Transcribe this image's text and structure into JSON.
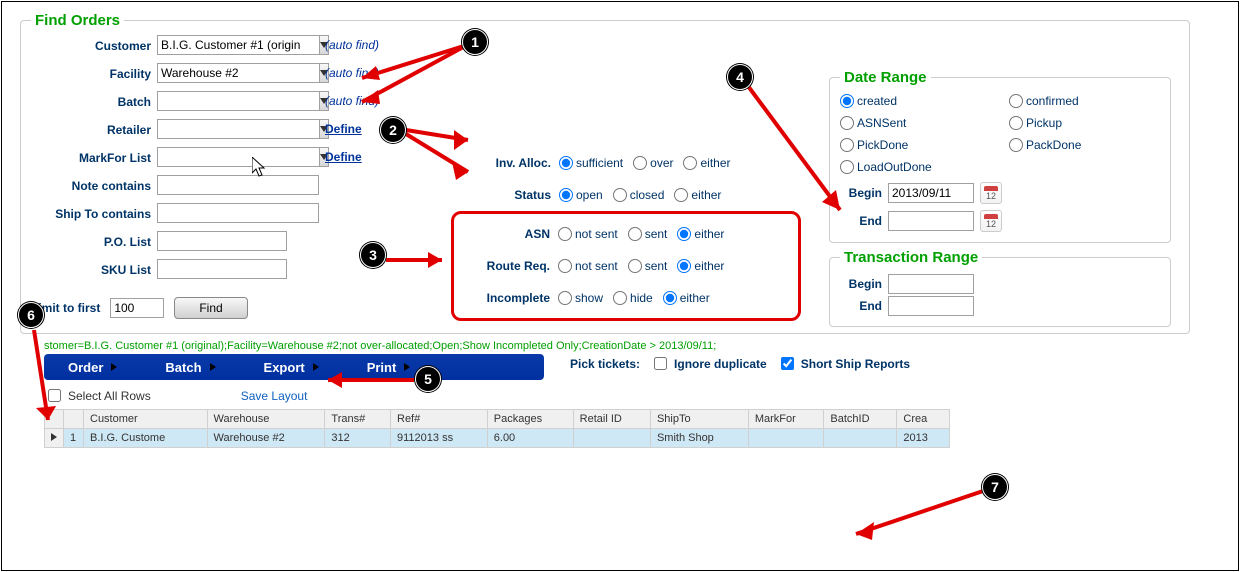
{
  "findOrders": {
    "legend": "Find Orders",
    "fields": {
      "customer": {
        "label": "Customer",
        "value": "B.I.G. Customer #1 (origin",
        "auto": "(auto find)"
      },
      "facility": {
        "label": "Facility",
        "value": "Warehouse #2",
        "auto": "(auto find)"
      },
      "batch": {
        "label": "Batch",
        "value": "",
        "auto": "(auto find)"
      },
      "retailer": {
        "label": "Retailer",
        "value": "",
        "define": "Define"
      },
      "markfor": {
        "label": "MarkFor List",
        "value": "",
        "define": "Define"
      },
      "note": {
        "label": "Note contains",
        "value": ""
      },
      "shipto": {
        "label": "Ship To contains",
        "value": ""
      },
      "po": {
        "label": "P.O. List",
        "value": ""
      },
      "sku": {
        "label": "SKU List",
        "value": ""
      }
    }
  },
  "midFilters": {
    "invAlloc": {
      "label": "Inv. Alloc.",
      "opts": [
        "sufficient",
        "over",
        "either"
      ],
      "sel": "sufficient"
    },
    "status": {
      "label": "Status",
      "opts": [
        "open",
        "closed",
        "either"
      ],
      "sel": "open"
    },
    "asn": {
      "label": "ASN",
      "opts": [
        "not sent",
        "sent",
        "either"
      ],
      "sel": "either"
    },
    "routeReq": {
      "label": "Route Req.",
      "opts": [
        "not sent",
        "sent",
        "either"
      ],
      "sel": "either"
    },
    "incomplete": {
      "label": "Incomplete",
      "opts": [
        "show",
        "hide",
        "either"
      ],
      "sel": "either"
    }
  },
  "dateRange": {
    "legend": "Date Range",
    "opts": [
      "created",
      "confirmed",
      "ASNSent",
      "Pickup",
      "PickDone",
      "PackDone",
      "LoadOutDone"
    ],
    "sel": "created",
    "beginLabel": "Begin",
    "begin": "2013/09/11",
    "endLabel": "End",
    "end": ""
  },
  "transRange": {
    "legend": "Transaction Range",
    "beginLabel": "Begin",
    "begin": "",
    "endLabel": "End",
    "end": ""
  },
  "limit": {
    "label": "Limit to first",
    "value": "100",
    "find": "Find"
  },
  "statusLine": "stomer=B.I.G. Customer #1 (original);Facility=Warehouse #2;not over-allocated;Open;Show Incompleted Only;CreationDate > 2013/09/11;",
  "menu": [
    "Order",
    "Batch",
    "Export",
    "Print"
  ],
  "pickTickets": {
    "label": "Pick tickets:",
    "ignore": "Ignore duplicate",
    "short": "Short Ship Reports"
  },
  "selectAll": "Select All Rows",
  "saveLayout": "Save Layout",
  "grid": {
    "headers": [
      "",
      "#",
      "Customer",
      "Warehouse",
      "Trans#",
      "Ref#",
      "Packages",
      "Retail ID",
      "ShipTo",
      "MarkFor",
      "BatchID",
      "Crea"
    ],
    "row": {
      "n": "1",
      "customer": "B.I.G. Custome",
      "warehouse": "Warehouse #2",
      "trans": "312",
      "ref": "9112013 ss",
      "packages": "6.00",
      "retail": "",
      "shipto": "Smith Shop",
      "markfor": "",
      "batchid": "",
      "crea": "2013"
    }
  }
}
